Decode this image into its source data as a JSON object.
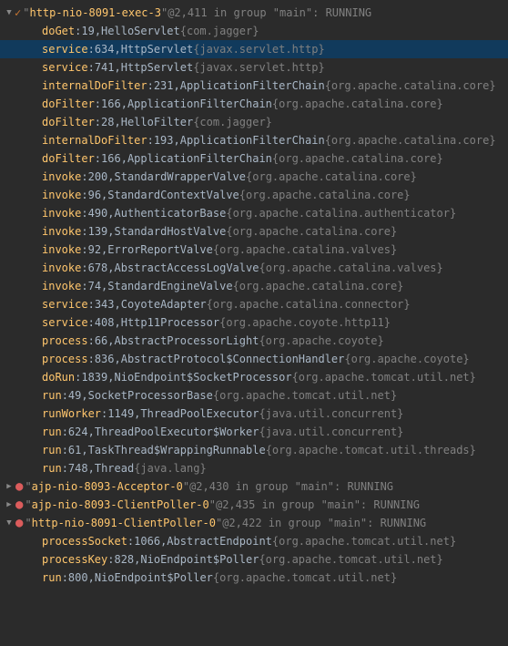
{
  "threads": [
    {
      "name": "http-nio-8091-exec-3",
      "id": "@2,411",
      "group": "main",
      "state": "RUNNING",
      "expanded": true,
      "marker": "check",
      "frames": [
        {
          "method": "doGet",
          "line": "19",
          "cls": "HelloServlet",
          "pkg": "com.jagger",
          "selected": false
        },
        {
          "method": "service",
          "line": "634",
          "cls": "HttpServlet",
          "pkg": "javax.servlet.http",
          "selected": true
        },
        {
          "method": "service",
          "line": "741",
          "cls": "HttpServlet",
          "pkg": "javax.servlet.http",
          "selected": false
        },
        {
          "method": "internalDoFilter",
          "line": "231",
          "cls": "ApplicationFilterChain",
          "pkg": "org.apache.catalina.core",
          "selected": false
        },
        {
          "method": "doFilter",
          "line": "166",
          "cls": "ApplicationFilterChain",
          "pkg": "org.apache.catalina.core",
          "selected": false
        },
        {
          "method": "doFilter",
          "line": "28",
          "cls": "HelloFilter",
          "pkg": "com.jagger",
          "selected": false
        },
        {
          "method": "internalDoFilter",
          "line": "193",
          "cls": "ApplicationFilterChain",
          "pkg": "org.apache.catalina.core",
          "selected": false
        },
        {
          "method": "doFilter",
          "line": "166",
          "cls": "ApplicationFilterChain",
          "pkg": "org.apache.catalina.core",
          "selected": false
        },
        {
          "method": "invoke",
          "line": "200",
          "cls": "StandardWrapperValve",
          "pkg": "org.apache.catalina.core",
          "selected": false
        },
        {
          "method": "invoke",
          "line": "96",
          "cls": "StandardContextValve",
          "pkg": "org.apache.catalina.core",
          "selected": false
        },
        {
          "method": "invoke",
          "line": "490",
          "cls": "AuthenticatorBase",
          "pkg": "org.apache.catalina.authenticator",
          "selected": false
        },
        {
          "method": "invoke",
          "line": "139",
          "cls": "StandardHostValve",
          "pkg": "org.apache.catalina.core",
          "selected": false
        },
        {
          "method": "invoke",
          "line": "92",
          "cls": "ErrorReportValve",
          "pkg": "org.apache.catalina.valves",
          "selected": false
        },
        {
          "method": "invoke",
          "line": "678",
          "cls": "AbstractAccessLogValve",
          "pkg": "org.apache.catalina.valves",
          "selected": false
        },
        {
          "method": "invoke",
          "line": "74",
          "cls": "StandardEngineValve",
          "pkg": "org.apache.catalina.core",
          "selected": false
        },
        {
          "method": "service",
          "line": "343",
          "cls": "CoyoteAdapter",
          "pkg": "org.apache.catalina.connector",
          "selected": false
        },
        {
          "method": "service",
          "line": "408",
          "cls": "Http11Processor",
          "pkg": "org.apache.coyote.http11",
          "selected": false
        },
        {
          "method": "process",
          "line": "66",
          "cls": "AbstractProcessorLight",
          "pkg": "org.apache.coyote",
          "selected": false
        },
        {
          "method": "process",
          "line": "836",
          "cls": "AbstractProtocol$ConnectionHandler",
          "pkg": "org.apache.coyote",
          "selected": false
        },
        {
          "method": "doRun",
          "line": "1839",
          "cls": "NioEndpoint$SocketProcessor",
          "pkg": "org.apache.tomcat.util.net",
          "selected": false
        },
        {
          "method": "run",
          "line": "49",
          "cls": "SocketProcessorBase",
          "pkg": "org.apache.tomcat.util.net",
          "selected": false
        },
        {
          "method": "runWorker",
          "line": "1149",
          "cls": "ThreadPoolExecutor",
          "pkg": "java.util.concurrent",
          "selected": false
        },
        {
          "method": "run",
          "line": "624",
          "cls": "ThreadPoolExecutor$Worker",
          "pkg": "java.util.concurrent",
          "selected": false
        },
        {
          "method": "run",
          "line": "61",
          "cls": "TaskThread$WrappingRunnable",
          "pkg": "org.apache.tomcat.util.threads",
          "selected": false
        },
        {
          "method": "run",
          "line": "748",
          "cls": "Thread",
          "pkg": "java.lang",
          "selected": false
        }
      ]
    },
    {
      "name": "ajp-nio-8093-Acceptor-0",
      "id": "@2,430",
      "group": "main",
      "state": "RUNNING",
      "expanded": false,
      "marker": "breakpoint",
      "frames": []
    },
    {
      "name": "ajp-nio-8093-ClientPoller-0",
      "id": "@2,435",
      "group": "main",
      "state": "RUNNING",
      "expanded": false,
      "marker": "breakpoint",
      "frames": []
    },
    {
      "name": "http-nio-8091-ClientPoller-0",
      "id": "@2,422",
      "group": "main",
      "state": "RUNNING",
      "expanded": true,
      "marker": "breakpoint",
      "frames": [
        {
          "method": "processSocket",
          "line": "1066",
          "cls": "AbstractEndpoint",
          "pkg": "org.apache.tomcat.util.net",
          "selected": false
        },
        {
          "method": "processKey",
          "line": "828",
          "cls": "NioEndpoint$Poller",
          "pkg": "org.apache.tomcat.util.net",
          "selected": false
        },
        {
          "method": "run",
          "line": "800",
          "cls": "NioEndpoint$Poller",
          "pkg": "org.apache.tomcat.util.net",
          "selected": false
        }
      ]
    }
  ],
  "labels": {
    "in_group": " in group ",
    "colon_space": ": "
  }
}
